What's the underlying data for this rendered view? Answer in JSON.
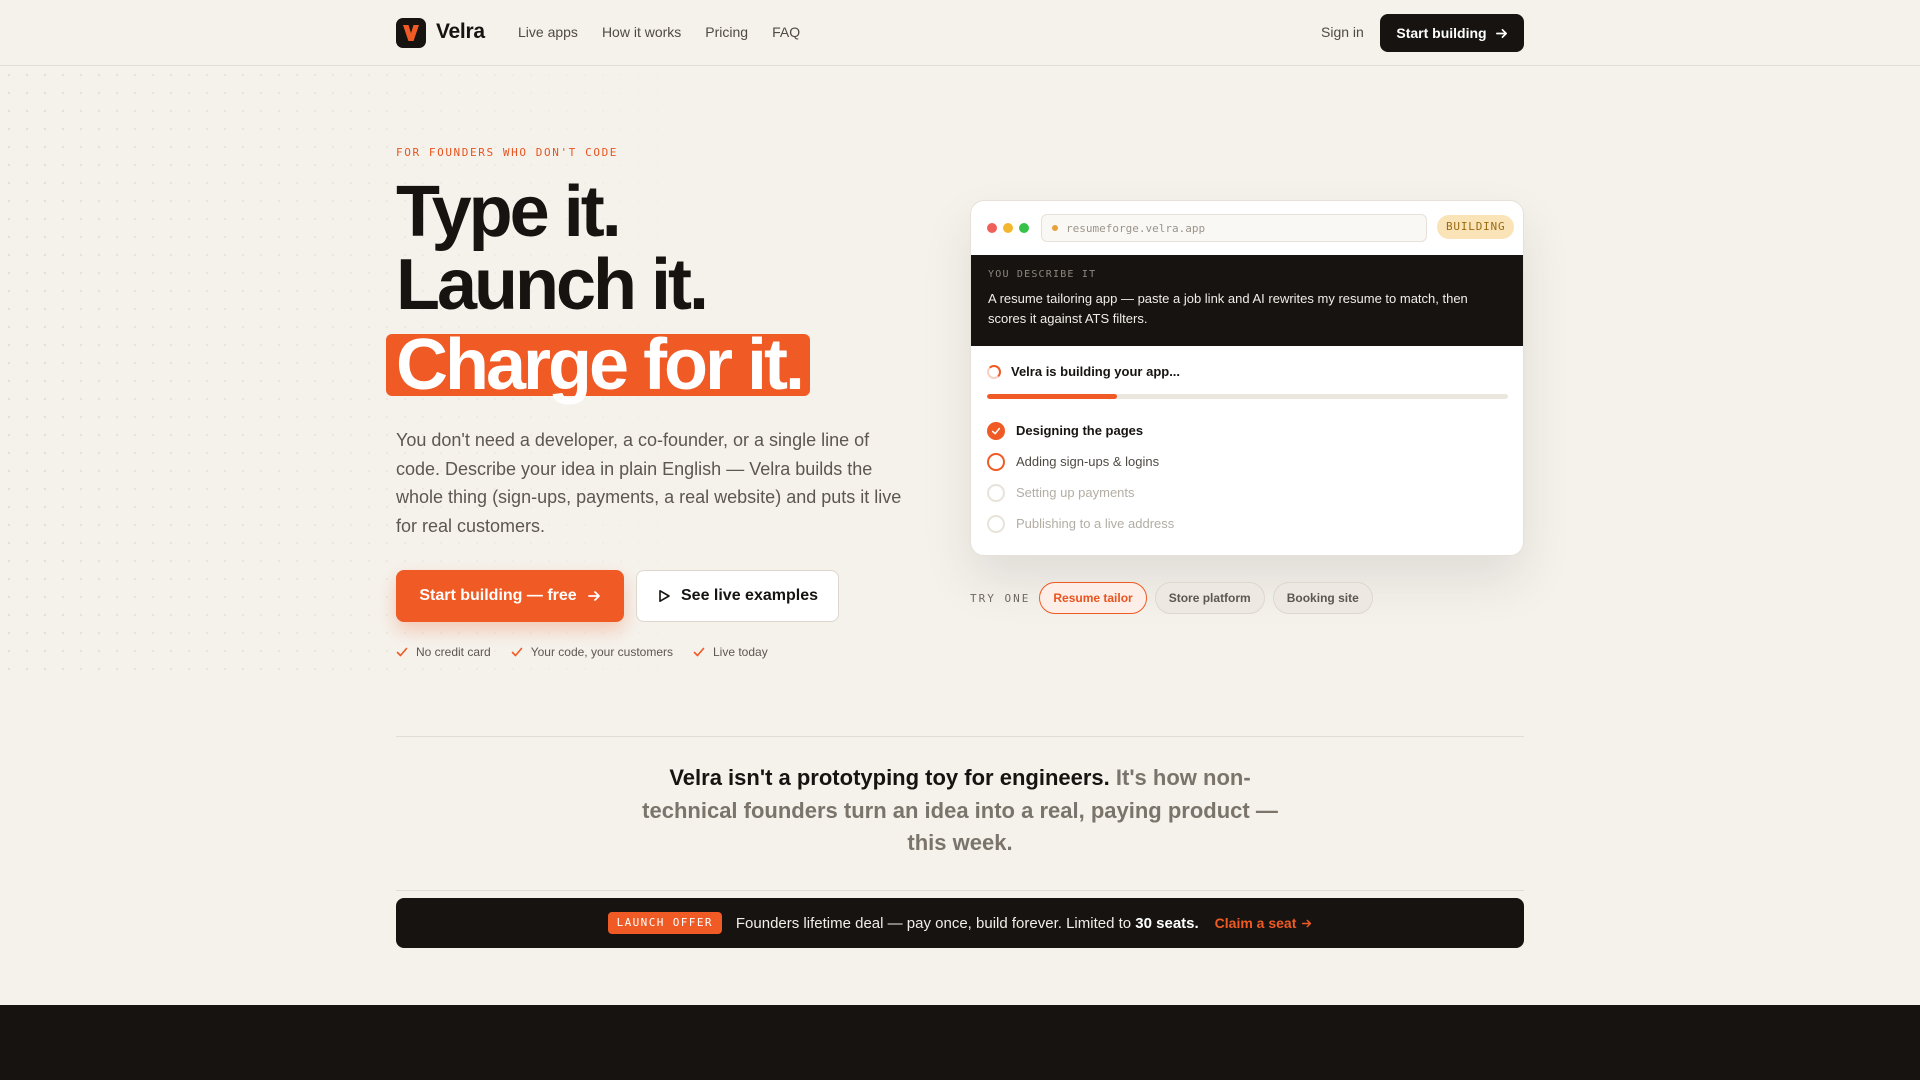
{
  "brand": {
    "name": "Velra",
    "accent": "#f05a24",
    "dark": "#161310",
    "background": "#f5f2ec"
  },
  "nav": {
    "links": [
      "Live apps",
      "How it works",
      "Pricing",
      "FAQ"
    ],
    "signin": "Sign in",
    "cta": "Start building"
  },
  "hero": {
    "eyebrow": "FOR FOUNDERS WHO DON'T CODE",
    "line1": "Type it.",
    "line2": "Launch it.",
    "line3": "Charge for it.",
    "lead": "You don't need a developer, a co-founder, or a single line of code. Describe your idea in plain English — Velra builds the whole thing (sign-ups, payments, a real website) and puts it live for real customers.",
    "primary_cta": "Start building — free",
    "secondary_cta": "See live examples",
    "ticks": [
      "No credit card",
      "Your code, your customers",
      "Live today"
    ]
  },
  "preview": {
    "url": "resumeforge.velra.app",
    "badge": "BUILDING",
    "describe_label": "YOU DESCRIBE IT",
    "describe_text": "A resume tailoring app — paste a job link and AI rewrites my resume to match, then scores it against ATS filters.",
    "status": "Velra is building your app...",
    "progress": 0.25,
    "steps": [
      {
        "label": "Designing the pages",
        "state": "done"
      },
      {
        "label": "Adding sign-ups & logins",
        "state": "active"
      },
      {
        "label": "Setting up payments",
        "state": "todo"
      },
      {
        "label": "Publishing to a live address",
        "state": "todo"
      }
    ]
  },
  "tryone": {
    "label": "TRY ONE",
    "chips": [
      {
        "label": "Resume tailor",
        "active": true
      },
      {
        "label": "Store platform",
        "active": false
      },
      {
        "label": "Booking site",
        "active": false
      }
    ]
  },
  "statement": {
    "dark": "Velra isn't a prototyping toy for engineers.",
    "muted": "It's how non-technical founders turn an idea into a real, paying product — this week."
  },
  "offer": {
    "badge": "LAUNCH OFFER",
    "text": "Founders lifetime deal — pay once, build forever. Limited to",
    "seats": "30 seats.",
    "link": "Claim a seat"
  }
}
